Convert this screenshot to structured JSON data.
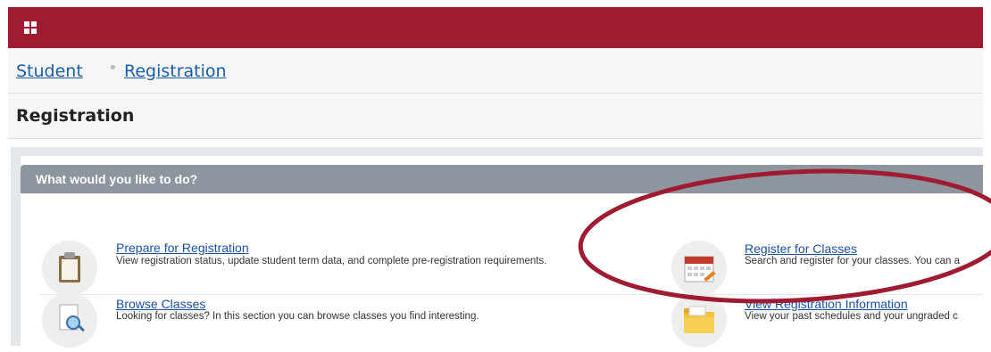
{
  "topbar": {
    "menu_icon": "grid-menu-icon",
    "color": "#9e1b32"
  },
  "breadcrumb": {
    "items": [
      "Student",
      "Registration"
    ]
  },
  "page": {
    "title": "Registration"
  },
  "panel": {
    "header": "What would you like to do?",
    "items": [
      {
        "link": "Prepare for Registration",
        "description": "View registration status, update student term data, and complete pre-registration requirements.",
        "icon": "clipboard-icon"
      },
      {
        "link": "Register for Classes",
        "description": "Search and register for your classes. You can a",
        "icon": "calendar-icon"
      },
      {
        "link": "Browse Classes",
        "description": "Looking for classes? In this section you can browse classes you find interesting.",
        "icon": "magnifier-document-icon"
      },
      {
        "link": "View Registration Information",
        "description": "View your past schedules and your ungraded c",
        "icon": "folder-icon"
      }
    ]
  },
  "annotation": {
    "shape": "ellipse",
    "color": "#9e1b32"
  }
}
